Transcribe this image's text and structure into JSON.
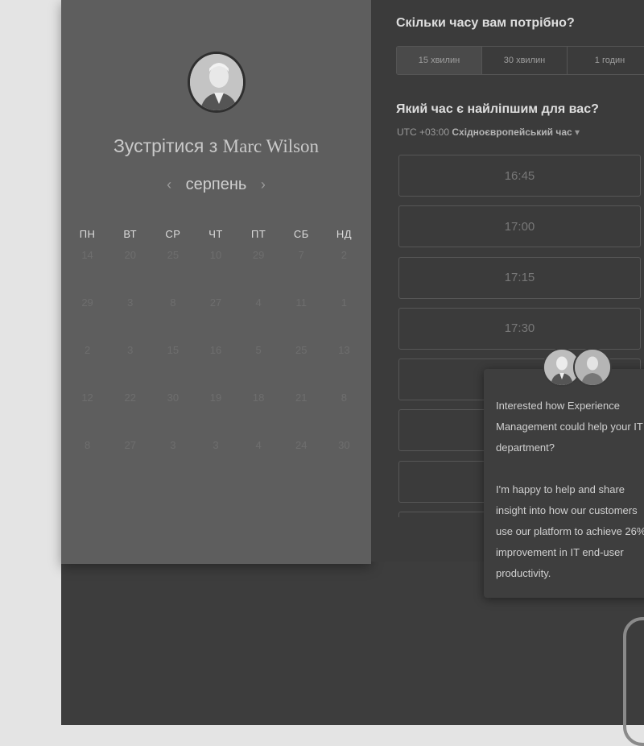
{
  "meeting": {
    "title_prefix": "Зустрітися з",
    "host_name": "Marc Wilson"
  },
  "calendar": {
    "month": "серпень",
    "prev_arrow": "‹",
    "next_arrow": "›",
    "weekdays": [
      "ПН",
      "ВТ",
      "СР",
      "ЧТ",
      "ПТ",
      "СБ",
      "НД"
    ],
    "weeks": [
      [
        "14",
        "20",
        "25",
        "10",
        "29",
        "7",
        "2"
      ],
      [
        "29",
        "3",
        "8",
        "27",
        "4",
        "11",
        "1"
      ],
      [
        "2",
        "3",
        "15",
        "16",
        "5",
        "25",
        "13"
      ],
      [
        "12",
        "22",
        "30",
        "19",
        "18",
        "21",
        "8"
      ],
      [
        "8",
        "27",
        "3",
        "3",
        "4",
        "24",
        "30"
      ]
    ]
  },
  "duration": {
    "question": "Скільки часу вам потрібно?",
    "options": [
      "15 хвилин",
      "30 хвилин",
      "1 годин"
    ],
    "selected": "15 хвилин"
  },
  "time": {
    "question": "Який час є найліпшим для вас?",
    "timezone_offset": "UTC +03:00",
    "timezone_name": "Східноєвропейський час",
    "dropdown_arrow": "▾",
    "slots": [
      "16:45",
      "17:00",
      "17:15",
      "17:30",
      "",
      "",
      "",
      ""
    ]
  },
  "chat": {
    "message_1": "Interested how Experience Management could help your IT department?",
    "message_2": "I'm happy to help and share insight into how our customers use our platform to achieve 26% improvement in IT end-user productivity."
  }
}
